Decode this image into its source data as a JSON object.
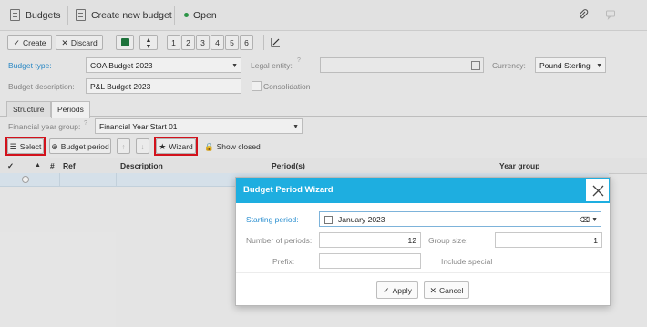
{
  "tabs": {
    "budgets": "Budgets",
    "create_new": "Create new budget",
    "open": "Open"
  },
  "toolbar": {
    "create": "Create",
    "discard": "Discard",
    "pages": [
      "1",
      "2",
      "3",
      "4",
      "5",
      "6"
    ]
  },
  "form": {
    "budget_type_label": "Budget type:",
    "budget_type_value": "COA Budget 2023",
    "legal_entity_label": "Legal entity:",
    "legal_entity_value": "",
    "currency_label": "Currency:",
    "currency_value": "Pound Sterling",
    "budget_description_label": "Budget description:",
    "budget_description_value": "P&L Budget 2023",
    "consolidation_label": "Consolidation"
  },
  "page_tabs": {
    "structure": "Structure",
    "periods": "Periods"
  },
  "periods": {
    "financial_year_group_label": "Financial year group:",
    "financial_year_group_value": "Financial Year Start 01",
    "select": "Select",
    "budget_period": "Budget period",
    "wizard": "Wizard",
    "show_closed": "Show closed"
  },
  "grid": {
    "columns": {
      "hash": "#",
      "ref": "Ref",
      "description": "Description",
      "periods": "Period(s)",
      "year_group": "Year group"
    }
  },
  "dialog": {
    "title": "Budget Period Wizard",
    "starting_period_label": "Starting period:",
    "starting_period_value": "January 2023",
    "number_of_periods_label": "Number of periods:",
    "number_of_periods_value": "12",
    "group_size_label": "Group size:",
    "group_size_value": "1",
    "prefix_label": "Prefix:",
    "prefix_value": "",
    "include_special_label": "Include special",
    "apply": "Apply",
    "cancel": "Cancel"
  },
  "colors": {
    "accent": "#1eaee0",
    "label_blue": "#2a8fd0",
    "highlight": "#e0141e",
    "status_green": "#2e9e4b"
  }
}
